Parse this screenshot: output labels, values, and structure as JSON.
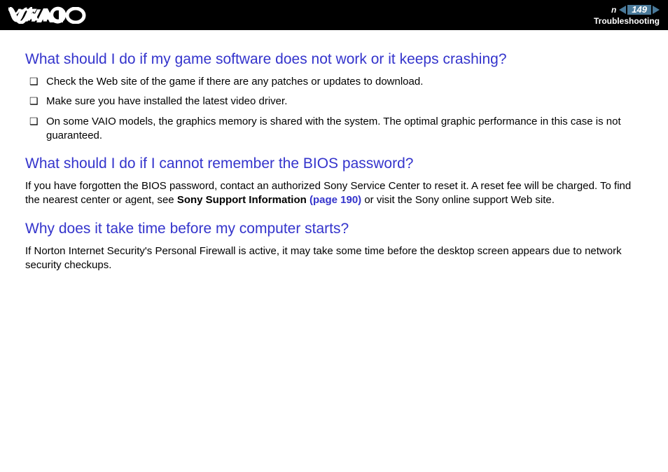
{
  "header": {
    "page_number": "149",
    "label_n": "n",
    "section_label": "Troubleshooting"
  },
  "content": {
    "sections": [
      {
        "heading": "What should I do if my game software does not work or it keeps crashing?",
        "bullets": [
          "Check the Web site of the game if there are any patches or updates to download.",
          "Make sure you have installed the latest video driver.",
          "On some VAIO models, the graphics memory is shared with the system. The optimal graphic performance in this case is not guaranteed."
        ]
      },
      {
        "heading": "What should I do if I cannot remember the BIOS password?",
        "para_pre": "If you have forgotten the BIOS password, contact an authorized Sony Service Center to reset it. A reset fee will be charged. To find the nearest center or agent, see ",
        "bold_text": "Sony Support Information ",
        "link_text": "(page 190)",
        "para_post": " or visit the Sony online support Web site."
      },
      {
        "heading": "Why does it take time before my computer starts?",
        "para": "If Norton Internet Security's Personal Firewall is active, it may take some time before the desktop screen appears due to network security checkups."
      }
    ]
  }
}
